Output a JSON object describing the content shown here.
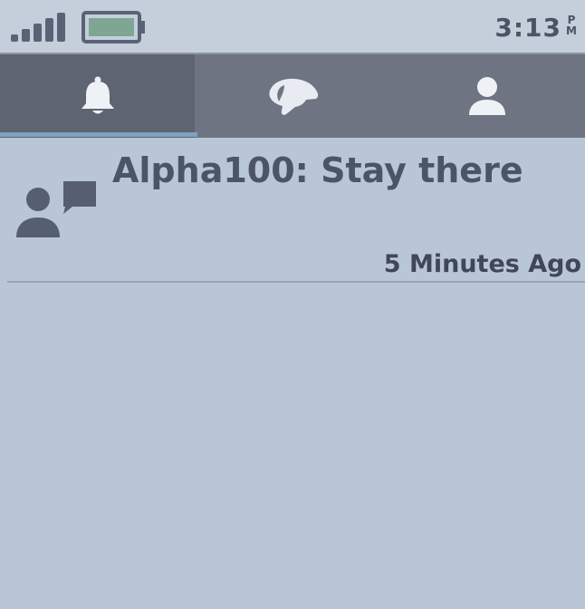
{
  "status_bar": {
    "time": "3:13",
    "ampm_top": "P",
    "ampm_bottom": "M",
    "signal_icon": "signal-strength-icon",
    "battery_icon": "battery-icon",
    "battery_color": "#7fa593"
  },
  "tabs": [
    {
      "id": "alerts",
      "icon": "bell-icon",
      "selected": true
    },
    {
      "id": "dogs",
      "icon": "dog-head-icon",
      "selected": false
    },
    {
      "id": "profile",
      "icon": "person-icon",
      "selected": false
    }
  ],
  "colors": {
    "background": "#b9c6d6",
    "tab_bar": "#6e7482",
    "tab_selected": "#5e6472",
    "tab_indicator": "#7fa2bd",
    "text": "#4c5568"
  },
  "messages": [
    {
      "icon": "chat-user-icon",
      "text": "Alpha100: Stay there",
      "time": "5 Minutes Ago"
    }
  ]
}
